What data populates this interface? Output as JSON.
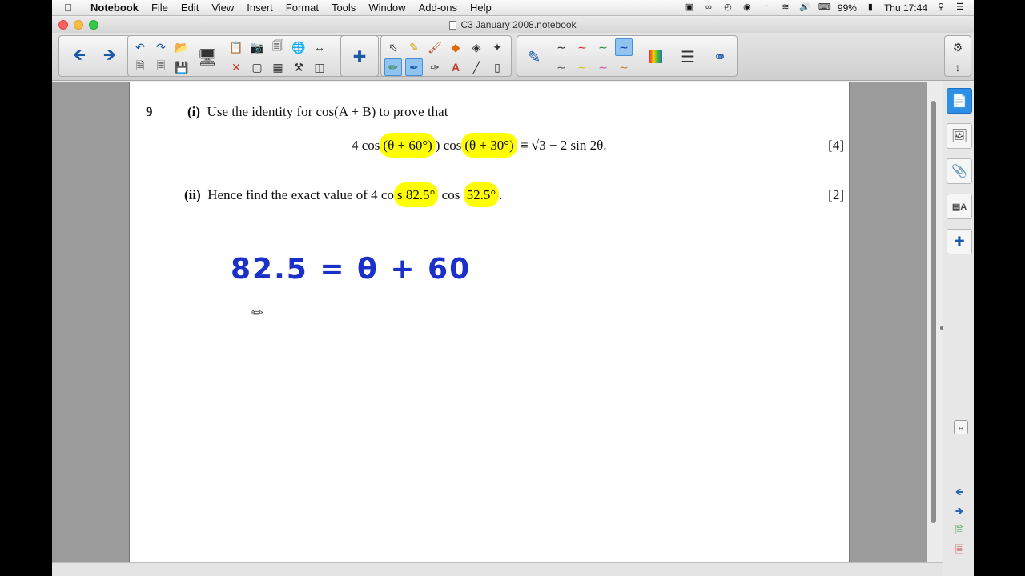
{
  "menubar": {
    "app_name": "Notebook",
    "items": [
      "File",
      "Edit",
      "View",
      "Insert",
      "Format",
      "Tools",
      "Window",
      "Add-ons",
      "Help"
    ],
    "battery": "99%",
    "clock": "Thu 17:44"
  },
  "window": {
    "title": "C3 January 2008.notebook"
  },
  "question": {
    "number": "9",
    "part1_label": "(i)",
    "part1_text": "Use the identity for cos(A + B) to prove that",
    "eq_prefix": "4 cos",
    "eq_h1": "(θ + 60°)",
    "eq_mid": ") cos",
    "eq_h2": "(θ + 30°)",
    "eq_suffix": " ≡ √3 − 2 sin 2θ.",
    "part1_marks": "[4]",
    "part2_label": "(ii)",
    "part2_text": "Hence find the exact value of 4 co",
    "part2_h1": "s 82.5°",
    "part2_mid": " cos ",
    "part2_h2": "52.5°",
    "part2_end": ".",
    "part2_marks": "[2]"
  },
  "handwriting": {
    "line1": "82.5 = θ + 60"
  },
  "colors": {
    "highlight": "#ffff00",
    "ink": "#1b2fc9",
    "side_active": "#2e8de4"
  }
}
